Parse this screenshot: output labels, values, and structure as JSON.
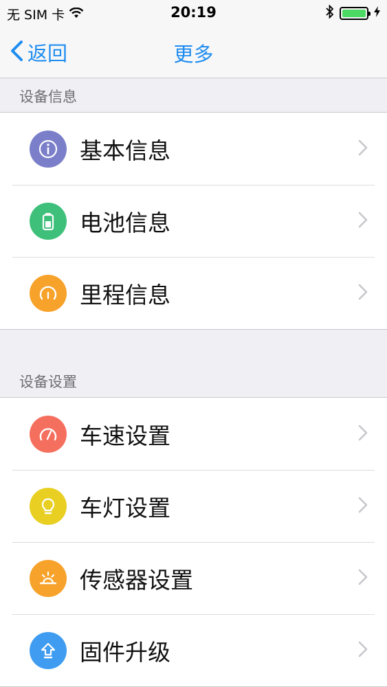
{
  "status_bar": {
    "carrier": "无 SIM 卡",
    "time": "20:19"
  },
  "nav": {
    "back_label": "返回",
    "title": "更多"
  },
  "sections": [
    {
      "header": "设备信息",
      "items": [
        {
          "label": "基本信息",
          "icon": "info-icon",
          "color": "#7b7fc9"
        },
        {
          "label": "电池信息",
          "icon": "battery-icon",
          "color": "#3ec07a"
        },
        {
          "label": "里程信息",
          "icon": "gauge-icon",
          "color": "#f7a22a"
        }
      ]
    },
    {
      "header": "设备设置",
      "items": [
        {
          "label": "车速设置",
          "icon": "speedometer-icon",
          "color": "#f56f5e"
        },
        {
          "label": "车灯设置",
          "icon": "light-bulb-icon",
          "color": "#e8cf22"
        },
        {
          "label": "传感器设置",
          "icon": "sensor-icon",
          "color": "#f7a22a"
        },
        {
          "label": "固件升级",
          "icon": "upgrade-arrow-icon",
          "color": "#3f9cf0"
        }
      ]
    }
  ],
  "colors": {
    "accent": "#1e8cf0",
    "background": "#efeff4"
  }
}
